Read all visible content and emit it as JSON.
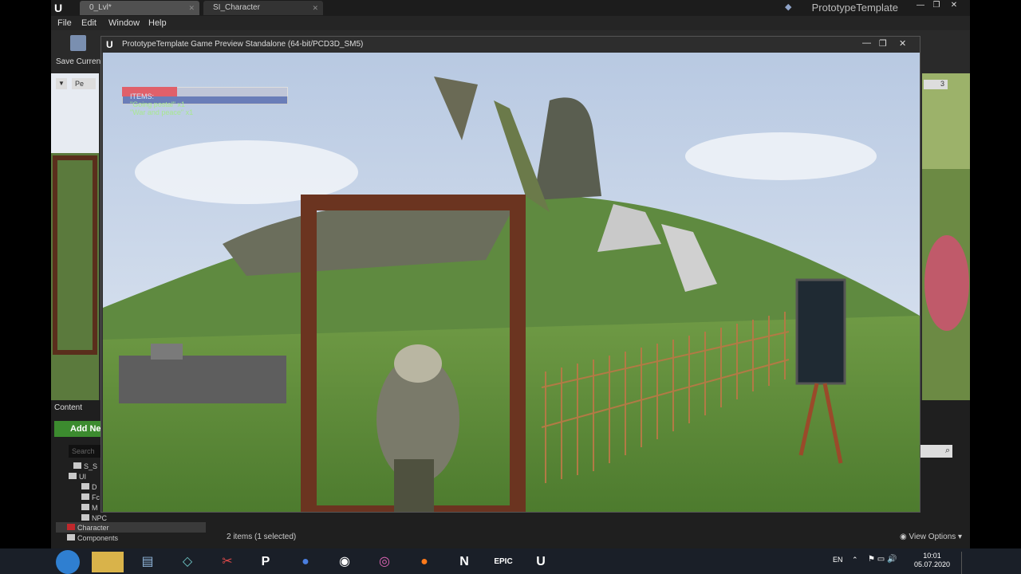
{
  "editor": {
    "tabs": [
      {
        "label": "0_Lvl*"
      },
      {
        "label": "SI_Character"
      }
    ],
    "project_name": "PrototypeTemplate",
    "menu": [
      "File",
      "Edit",
      "Window",
      "Help"
    ],
    "toolbar": {
      "save_label": "Save Current"
    },
    "viewport_mode_label": "Pe",
    "viewport_count": "3",
    "content_browser": {
      "tab_label": "Content",
      "add_new_label": "Add Ne",
      "search_placeholder": "Search",
      "tree": [
        "S_S",
        "UI",
        "D",
        "Fc",
        "M",
        "NPC",
        "Character",
        "Components"
      ],
      "status": "2 items (1 selected)",
      "view_options": "View Options"
    }
  },
  "game_window": {
    "title": "PrototypeTemplate Game Preview Standalone (64-bit/PCD3D_SM5)",
    "hud": {
      "items_label": "ITEMS:",
      "items": [
        "\"Going postal\" x1",
        "\"War and peace\" x1"
      ],
      "bar_fill": 0.33
    }
  },
  "taskbar": {
    "language": "EN",
    "time": "10:01",
    "date": "05.07.2020",
    "icons": [
      "windows-start",
      "file-explorer",
      "notepad",
      "sticky-app",
      "snipping-tool",
      "p-app",
      "blue-circle-app",
      "obs",
      "color-app",
      "firefox",
      "notion",
      "epic-games",
      "unreal-engine"
    ]
  },
  "colors": {
    "sky": "#c9d6e8",
    "grass": "#5d8a3a",
    "frame_wood": "#6b3420",
    "hud_red": "#e0606a",
    "hud_blue": "#6a7db8"
  }
}
